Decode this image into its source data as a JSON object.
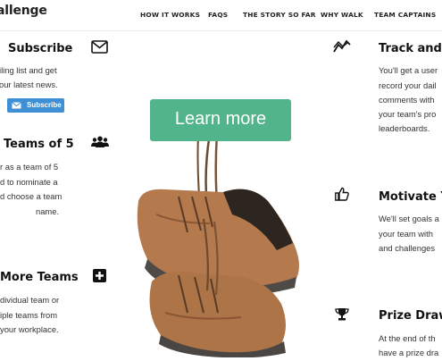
{
  "nav": {
    "brand": "allenge",
    "items": [
      "HOW IT WORKS",
      "FAQS",
      "THE STORY SO FAR",
      "WHY WALK",
      "TEAM CAPTAINS"
    ]
  },
  "subscribe": {
    "heading": "Subscribe",
    "lines": [
      "iling list and get",
      "our latest news."
    ],
    "button": "Subscribe",
    "icon": "envelope-icon"
  },
  "teams_of_5": {
    "heading": "Teams of 5",
    "lines": [
      "r as a team of 5",
      "d to nominate a",
      "d choose a team",
      "name."
    ],
    "icon": "group-icon"
  },
  "more_teams": {
    "heading": "More Teams",
    "lines": [
      "dividual team or",
      "iple teams from",
      "your workplace."
    ],
    "icon": "plus-square-icon"
  },
  "track": {
    "heading": "Track and C",
    "lines": [
      "You'll get a user",
      "record your dail",
      "comments with",
      "your team's pro",
      "leaderboards."
    ],
    "icon": "chart-line-icon"
  },
  "motivate": {
    "heading": "Motivate Yo",
    "lines": [
      "We'll set goals a",
      "your team with",
      "and challenges"
    ],
    "icon": "thumbs-up-icon"
  },
  "prize": {
    "heading": "Prize Draw",
    "lines": [
      "At the end of th",
      "have a prize dra"
    ],
    "icon": "trophy-icon"
  },
  "cta": {
    "label": "Learn more"
  },
  "colors": {
    "cta": "#52b48a",
    "subscribe_button": "#3f8fd6",
    "text": "#222222"
  }
}
